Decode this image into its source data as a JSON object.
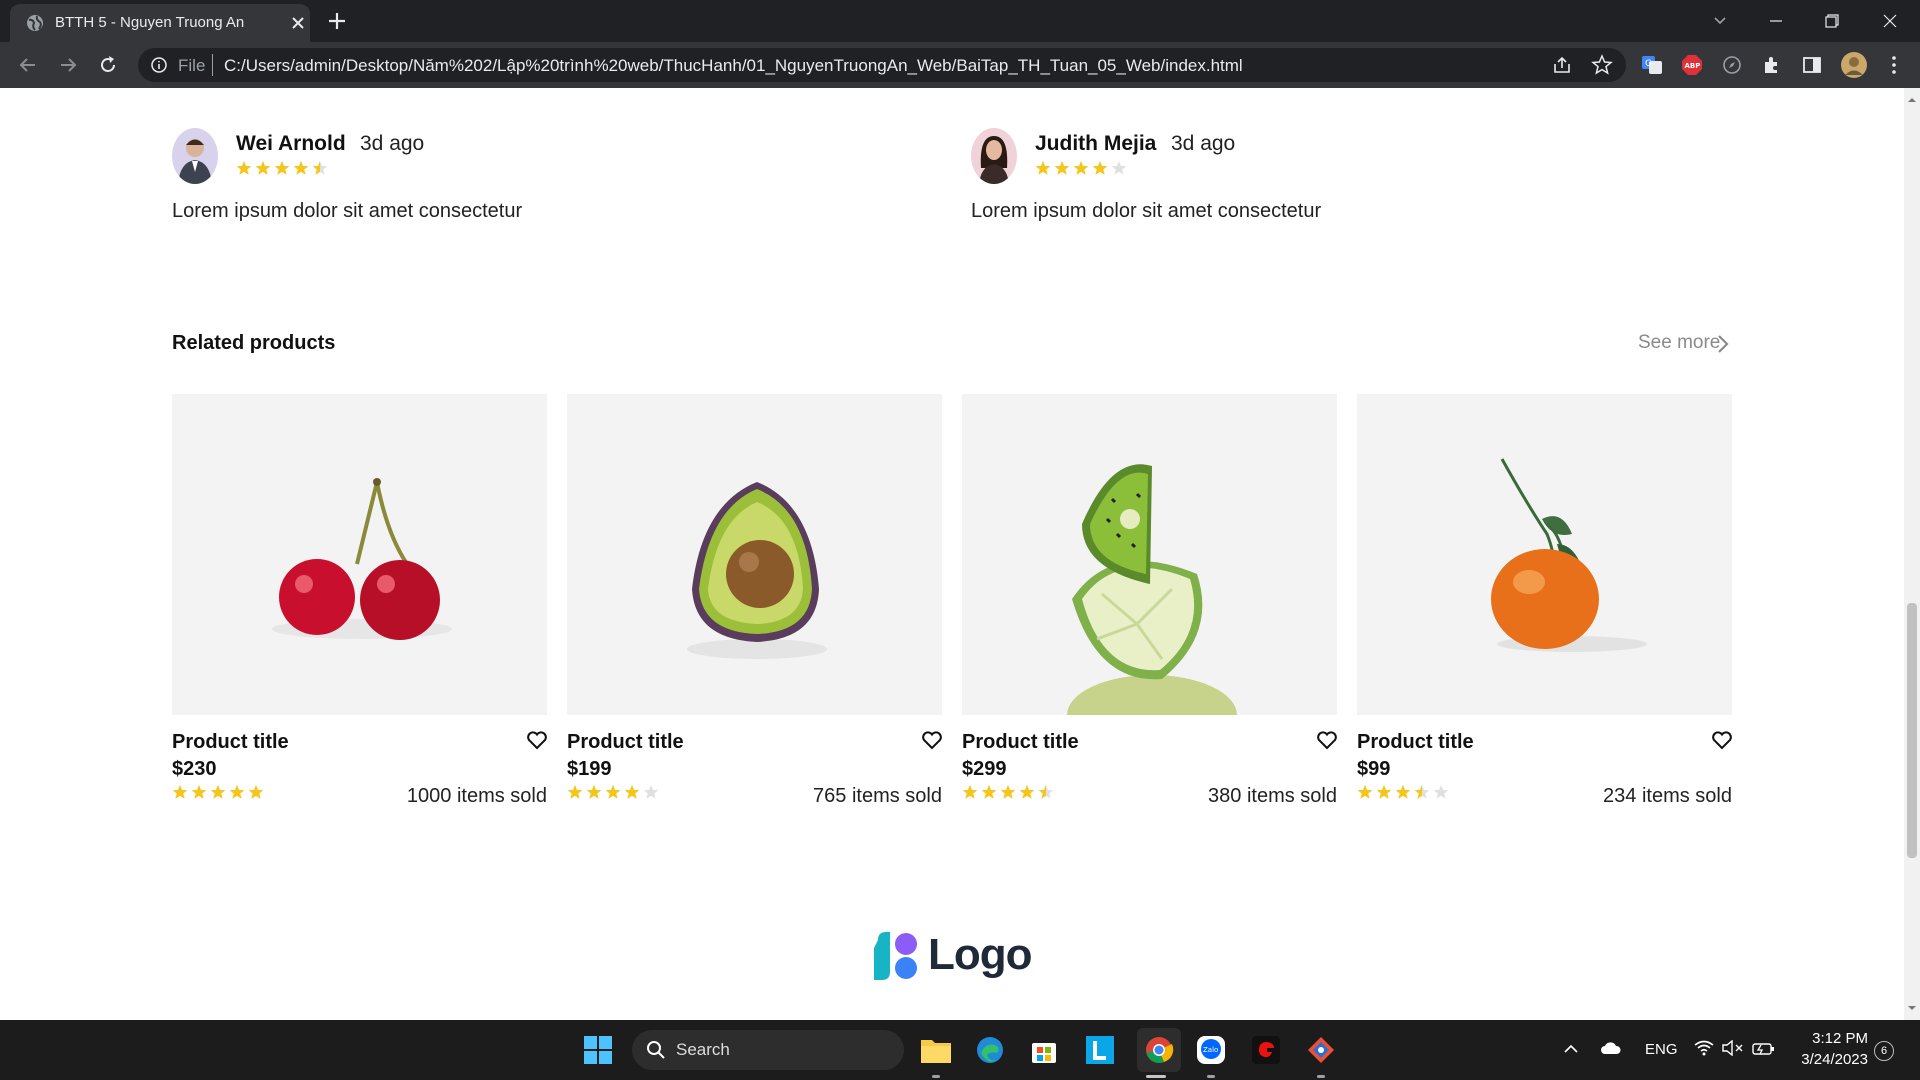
{
  "browser": {
    "tab_title": "BTTH 5 - Nguyen Truong An",
    "omnibox_prefix": "File",
    "url": "C:/Users/admin/Desktop/Năm%202/Lập%20trình%20web/ThucHanh/01_NguyenTruongAn_Web/BaiTap_TH_Tuan_05_Web/index.html"
  },
  "reviews": [
    {
      "name": "Wei Arnold",
      "time": "3d ago",
      "rating": 4.5,
      "text": "Lorem ipsum dolor sit amet consectetur"
    },
    {
      "name": "Judith Mejia",
      "time": "3d ago",
      "rating": 4,
      "text": "Lorem ipsum dolor sit amet consectetur"
    }
  ],
  "related": {
    "title": "Related products",
    "see_more": "See more",
    "products": [
      {
        "title": "Product title",
        "price": "$230",
        "rating": 5,
        "sold": "1000 items sold",
        "image": "cherry"
      },
      {
        "title": "Product title",
        "price": "$199",
        "rating": 4,
        "sold": "765 items sold",
        "image": "avocado"
      },
      {
        "title": "Product title",
        "price": "$299",
        "rating": 4.5,
        "sold": "380 items sold",
        "image": "kiwi-lime"
      },
      {
        "title": "Product title",
        "price": "$99",
        "rating": 3.5,
        "sold": "234 items sold",
        "image": "tangerine"
      }
    ]
  },
  "footer": {
    "logo_text": "Logo"
  },
  "taskbar": {
    "search_label": "Search",
    "language": "ENG",
    "time": "3:12 PM",
    "date": "3/24/2023",
    "notification_count": "6"
  },
  "colors": {
    "star": "#f5c518",
    "star_empty": "#e0e0e0",
    "chrome_dark": "#202124",
    "taskbar": "#1c1c1c"
  }
}
